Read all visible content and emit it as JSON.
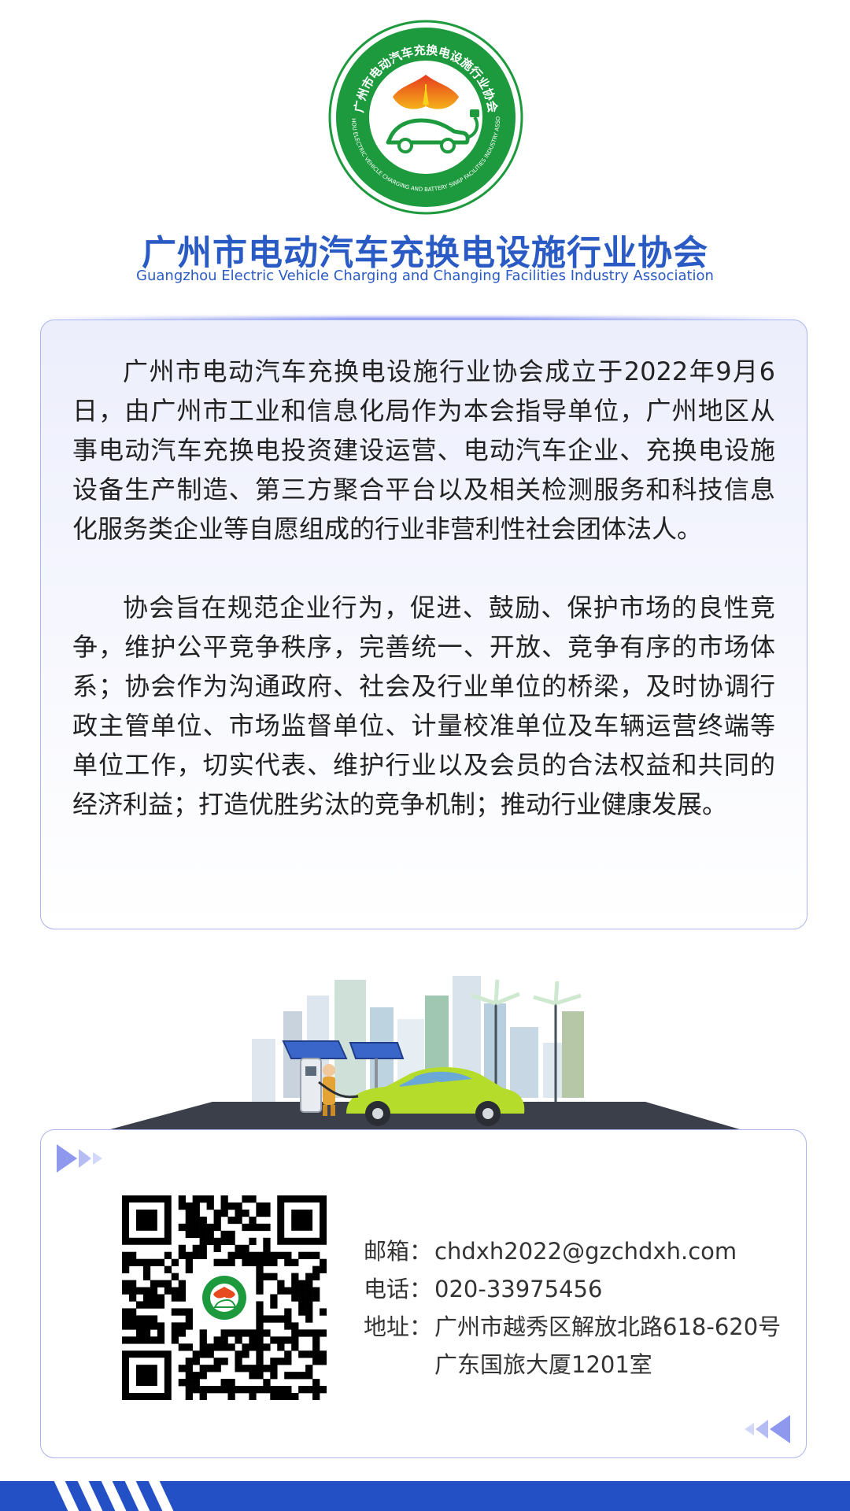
{
  "logo": {
    "ring_text_cn": "广州市电动汽车充换电设施行业协会",
    "ring_text_en": "GUANGZHOU ELECTRIC VEHICLE CHARGING AND BATTERY SWAP FACILITIES INDUSTRY ASSOCIATION"
  },
  "header": {
    "title": "广州市电动汽车充换电设施行业协会",
    "subtitle": "Guangzhou Electric Vehicle Charging and Changing Facilities Industry Association"
  },
  "intro": {
    "paragraphs": [
      "广州市电动汽车充换电设施行业协会成立于2022年9月6日，由广州市工业和信息化局作为本会指导单位，广州地区从事电动汽车充换电投资建设运营、电动汽车企业、充换电设施设备生产制造、第三方聚合平台以及相关检测服务和科技信息化服务类企业等自愿组成的行业非营利性社会团体法人。",
      "协会旨在规范企业行为，促进、鼓励、保护市场的良性竞争，维护公平竞争秩序，完善统一、开放、竞争有序的市场体系；协会作为沟通政府、社会及行业单位的桥梁，及时协调行政主管单位、市场监督单位、计量校准单位及车辆运营终端等单位工作，切实代表、维护行业以及会员的合法权益和共同的经济利益；打造优胜劣汰的竞争机制；推动行业健康发展。"
    ]
  },
  "contact": {
    "email_label": "邮箱：",
    "email": "chdxh2022@gzchdxh.com",
    "phone_label": "电话：",
    "phone": "020-33975456",
    "address_label": "地址：",
    "address_line1": "广州市越秀区解放北路618-620号",
    "address_line2": "广东国旅大厦1201室"
  },
  "colors": {
    "brand_blue": "#2a5bc4",
    "logo_green": "#1e9a3e",
    "card_border": "#aab4ee",
    "bottom_bar": "#2450c6"
  }
}
